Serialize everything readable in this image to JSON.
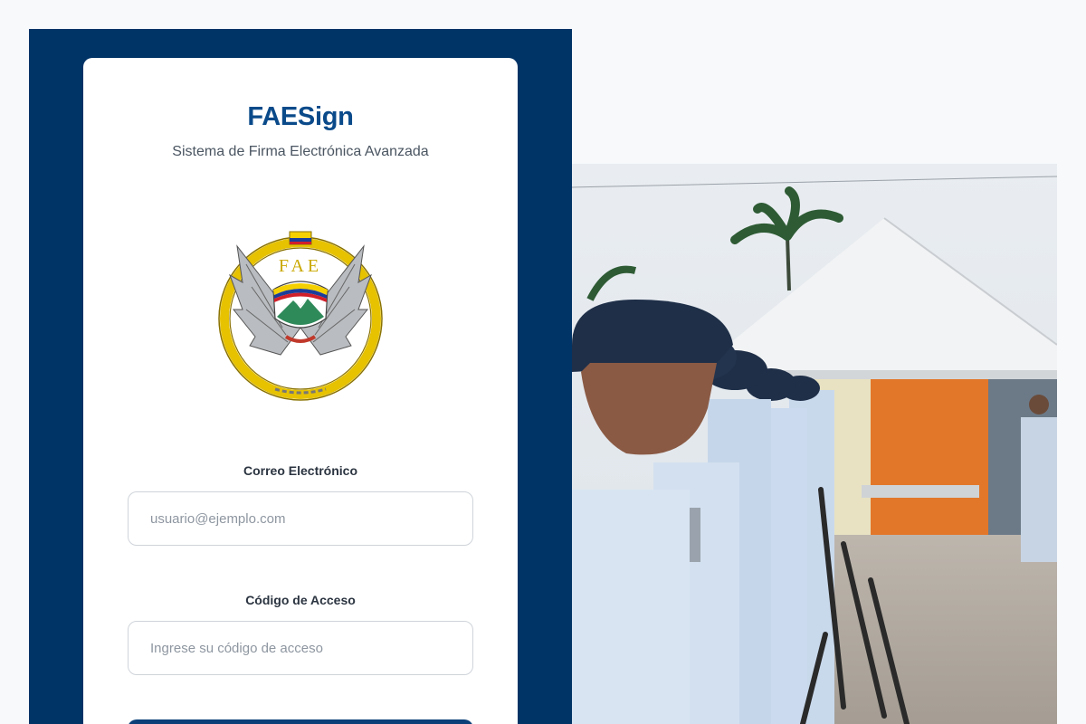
{
  "brand": {
    "title": "FAESign",
    "subtitle": "Sistema de Firma Electrónica Avanzada",
    "emblem_text": "FAE"
  },
  "form": {
    "email_label": "Correo Electrónico",
    "email_placeholder": "usuario@ejemplo.com",
    "email_value": "",
    "code_label": "Código de Acceso",
    "code_placeholder": "Ingrese su código de acceso",
    "code_value": ""
  },
  "colors": {
    "panel_blue": "#003366",
    "brand_blue": "#0a4a8a",
    "button_blue": "#0a3f78",
    "emblem_gold": "#e6c200"
  },
  "icons": [
    "fae-emblem-logo"
  ]
}
